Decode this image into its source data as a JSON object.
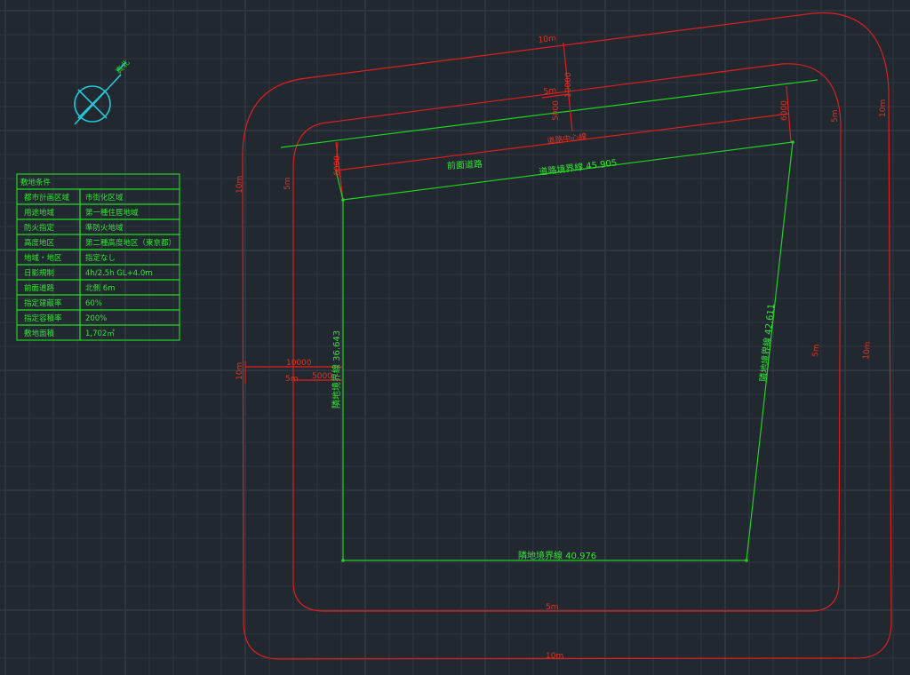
{
  "colors": {
    "background": "#212830",
    "setback_lines": "#e01e1e",
    "boundary_lines": "#22d022",
    "north_symbol": "#22c8d8"
  },
  "north_arrow": {
    "label": "真北",
    "icon": "north-compass-icon"
  },
  "site_table": {
    "title": "敷地条件",
    "rows": [
      {
        "label": "都市計画区域",
        "value": "市街化区域"
      },
      {
        "label": "用途地域",
        "value": "第一種住居地域"
      },
      {
        "label": "防火指定",
        "value": "準防火地域"
      },
      {
        "label": "高度地区",
        "value": "第二種高度地区（東京都）"
      },
      {
        "label": "地域・地区",
        "value": "指定なし"
      },
      {
        "label": "日影規制",
        "value": "4h/2.5h GL+4.0m"
      },
      {
        "label": "前面道路",
        "value": "北側 6m"
      },
      {
        "label": "指定建蔽率",
        "value": "60%"
      },
      {
        "label": "指定容積率",
        "value": "200%"
      },
      {
        "label": "敷地面積",
        "value": "1,702㎡"
      }
    ]
  },
  "boundaries": {
    "road_boundary": "道路境界線 45.905",
    "east_boundary": "隣地境界線 42.611",
    "west_boundary": "隣地境界線 36.643",
    "south_boundary": "隣地境界線 40.976",
    "front_road": "前面道路",
    "road_centerline": "道路中心線"
  },
  "dimensions": {
    "offset_10m": "10m",
    "offset_5m": "5m",
    "d10000": "10000",
    "d5000": "5000",
    "d6000": "6000"
  }
}
